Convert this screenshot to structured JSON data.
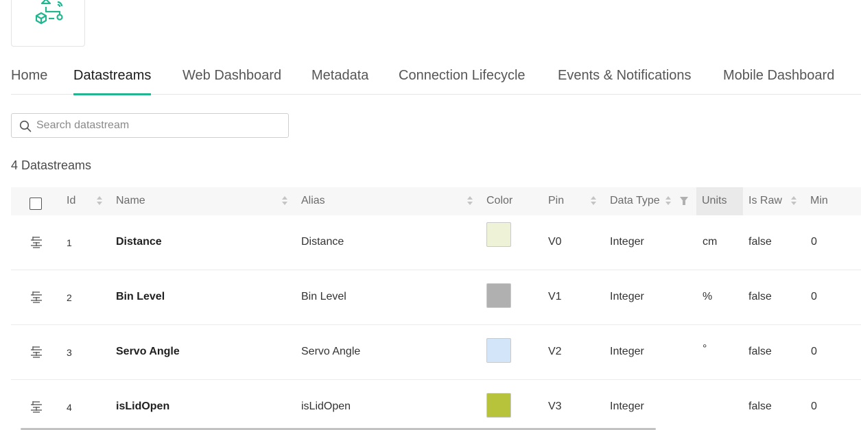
{
  "tabs": [
    {
      "label": "Home"
    },
    {
      "label": "Datastreams"
    },
    {
      "label": "Web Dashboard"
    },
    {
      "label": "Metadata"
    },
    {
      "label": "Connection Lifecycle"
    },
    {
      "label": "Events & Notifications"
    },
    {
      "label": "Mobile Dashboard"
    }
  ],
  "active_tab": "Datastreams",
  "search": {
    "placeholder": "Search datastream",
    "value": ""
  },
  "count_label": "4 Datastreams",
  "columns": {
    "id": "Id",
    "name": "Name",
    "alias": "Alias",
    "color": "Color",
    "pin": "Pin",
    "data_type": "Data Type",
    "units": "Units",
    "is_raw": "Is Raw",
    "min": "Min"
  },
  "rows": [
    {
      "id": "1",
      "name": "Distance",
      "alias": "Distance",
      "color": "#eef3d8",
      "pin": "V0",
      "data_type": "Integer",
      "units": "cm",
      "is_raw": "false",
      "min": "0"
    },
    {
      "id": "2",
      "name": "Bin Level",
      "alias": "Bin Level",
      "color": "#b0b0b0",
      "pin": "V1",
      "data_type": "Integer",
      "units": "%",
      "is_raw": "false",
      "min": "0"
    },
    {
      "id": "3",
      "name": "Servo Angle",
      "alias": "Servo Angle",
      "color": "#d3e5f8",
      "pin": "V2",
      "data_type": "Integer",
      "units": "°",
      "is_raw": "false",
      "min": "0"
    },
    {
      "id": "4",
      "name": "isLidOpen",
      "alias": "isLidOpen",
      "color": "#b8c33c",
      "pin": "V3",
      "data_type": "Integer",
      "units": "",
      "is_raw": "false",
      "min": "0"
    }
  ],
  "icons": {
    "logo": "template-logo-icon",
    "search": "search-icon",
    "drag": "drag-handle-icon",
    "sort": "sort-icon",
    "filter": "filter-icon"
  },
  "accent_color": "#23b58f"
}
